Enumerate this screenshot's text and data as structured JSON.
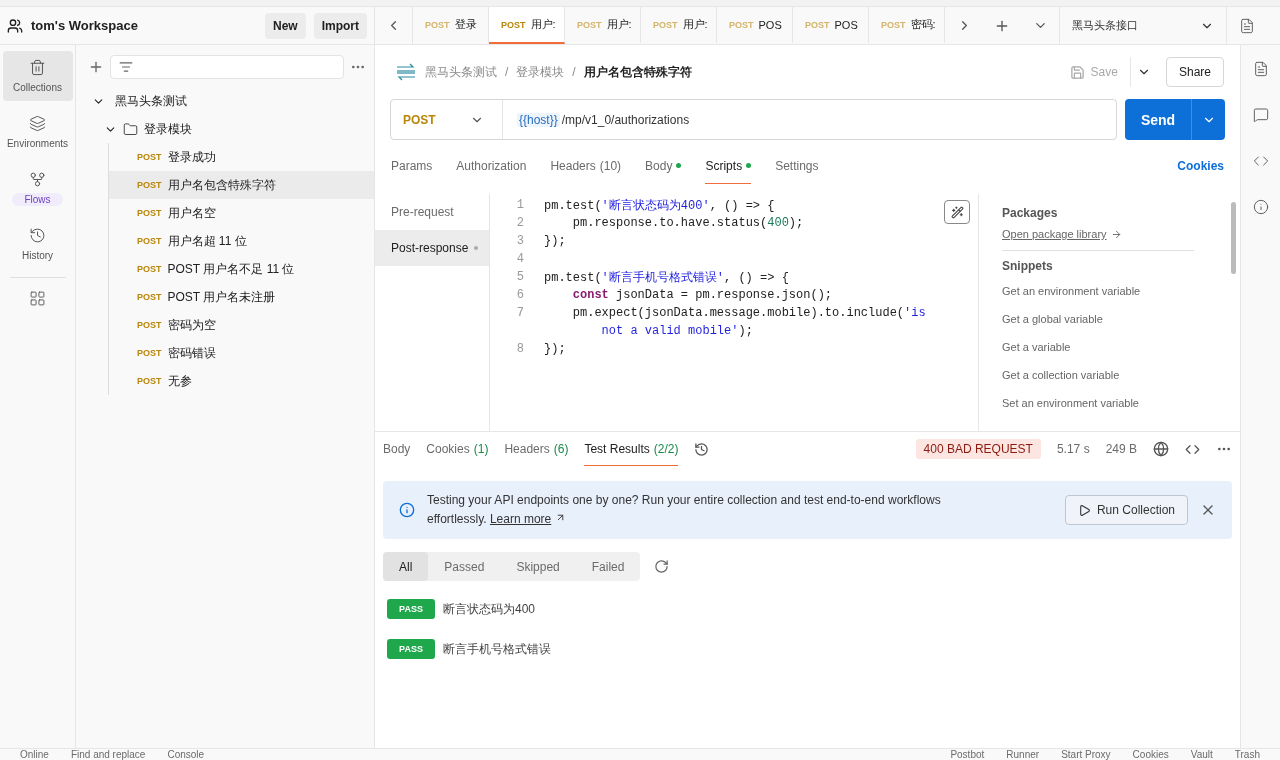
{
  "workspace": {
    "name": "tom's Workspace",
    "buttons": [
      "New",
      "Import"
    ]
  },
  "rail": [
    {
      "label": "Collections",
      "selected": true
    },
    {
      "label": "Environments",
      "selected": false
    },
    {
      "label": "Flows",
      "selected": false,
      "highlight": true
    },
    {
      "label": "History",
      "selected": false
    }
  ],
  "tree": [
    {
      "name": "黑马头条测试",
      "kind": "collection",
      "expanded": true,
      "children": [
        {
          "name": "登录模块",
          "kind": "folder",
          "expanded": true,
          "children": [
            {
              "kind": "request",
              "method": "POST",
              "name": "登录成功",
              "selected": false
            },
            {
              "kind": "request",
              "method": "POST",
              "name": "用户名包含特殊字符",
              "selected": true
            },
            {
              "kind": "request",
              "method": "POST",
              "name": "用户名空",
              "selected": false
            },
            {
              "kind": "request",
              "method": "POST",
              "name": "用户名超 11 位",
              "selected": false
            },
            {
              "kind": "request",
              "method": "POST",
              "name": "POST 用户名不足 11 位",
              "selected": false
            },
            {
              "kind": "request",
              "method": "POST",
              "name": "POST 用户名未注册",
              "selected": false
            },
            {
              "kind": "request",
              "method": "POST",
              "name": "密码为空",
              "selected": false
            },
            {
              "kind": "request",
              "method": "POST",
              "name": "密码错误",
              "selected": false
            },
            {
              "kind": "request",
              "method": "POST",
              "name": "无参",
              "selected": false
            }
          ]
        }
      ]
    }
  ],
  "tabs": [
    {
      "method": "POST",
      "title": "登录",
      "selected": false
    },
    {
      "method": "POST",
      "title": "用户:",
      "selected": true
    },
    {
      "method": "POST",
      "title": "用户:",
      "selected": false
    },
    {
      "method": "POST",
      "title": "用户:",
      "selected": false
    },
    {
      "method": "POST",
      "title": "POS",
      "selected": false
    },
    {
      "method": "POST",
      "title": "POS",
      "selected": false
    },
    {
      "method": "POST",
      "title": "密码:",
      "selected": false
    }
  ],
  "environment": "黑马头条接口",
  "breadcrumb": [
    {
      "kind": "crumb",
      "text": "黑马头条测试"
    },
    {
      "kind": "separator",
      "text": "/"
    },
    {
      "kind": "crumb",
      "text": "登录模块"
    },
    {
      "kind": "separator",
      "text": "/"
    },
    {
      "kind": "current",
      "text": "用户名包含特殊字符"
    }
  ],
  "actions": {
    "save": "Save",
    "share": "Share"
  },
  "request": {
    "method": "POST",
    "host": "{{host}}",
    "path": "/mp/v1_0/authorizations",
    "send": "Send"
  },
  "request_tabs": [
    {
      "label": "Params",
      "selected": false,
      "dot": false
    },
    {
      "label": "Authorization",
      "selected": false,
      "dot": false
    },
    {
      "label": "Headers",
      "count": "(10)",
      "selected": false,
      "dot": false
    },
    {
      "label": "Body",
      "selected": false,
      "dot": true
    },
    {
      "label": "Scripts",
      "selected": true,
      "dot": true
    },
    {
      "label": "Settings",
      "selected": false,
      "dot": false
    }
  ],
  "cookies_link": "Cookies",
  "script_tabs": [
    {
      "label": "Pre-request",
      "selected": false,
      "dot": false
    },
    {
      "label": "Post-response",
      "selected": true,
      "dot": true
    }
  ],
  "code": [
    {
      "number": "1",
      "tokens": [
        {
          "kind": "plain",
          "text": "pm.test("
        },
        {
          "kind": "string",
          "text": "'断言状态码为400'"
        },
        {
          "kind": "plain",
          "text": ", () => {"
        }
      ]
    },
    {
      "number": "2",
      "tokens": [
        {
          "kind": "plain",
          "text": "    pm.response.to.have.status("
        },
        {
          "kind": "number",
          "text": "400"
        },
        {
          "kind": "plain",
          "text": ");"
        }
      ]
    },
    {
      "number": "3",
      "tokens": [
        {
          "kind": "plain",
          "text": "});"
        }
      ]
    },
    {
      "number": "4"
    },
    {
      "number": "5",
      "tokens": [
        {
          "kind": "plain",
          "text": "pm.test("
        },
        {
          "kind": "string",
          "text": "'断言手机号格式错误'"
        },
        {
          "kind": "plain",
          "text": ", () => {"
        }
      ]
    },
    {
      "number": "6",
      "tokens": [
        {
          "kind": "keyword",
          "text": "    const"
        },
        {
          "kind": "plain",
          "text": " jsonData = pm.response.json();"
        }
      ]
    },
    {
      "number": "7",
      "tokens": [
        {
          "kind": "plain",
          "text": "    pm.expect(jsonData.message.mobile).to.include("
        },
        {
          "kind": "string",
          "text": "'is"
        }
      ]
    },
    {
      "tokens": [
        {
          "kind": "string",
          "text": "        not a valid mobile'"
        },
        {
          "kind": "plain",
          "text": ");"
        }
      ]
    },
    {
      "number": "8",
      "tokens": [
        {
          "kind": "plain",
          "text": "});"
        }
      ]
    }
  ],
  "snippets_panel": {
    "packages_title": "Packages",
    "packages_link": "Open package library",
    "snippets_title": "Snippets",
    "snippets": [
      "Get an environment variable",
      "Get a global variable",
      "Get a variable",
      "Get a collection variable",
      "Set an environment variable"
    ]
  },
  "response_tabs": [
    {
      "label": "Body",
      "selected": false
    },
    {
      "label": "Cookies",
      "count": "(1)",
      "selected": false
    },
    {
      "label": "Headers",
      "count": "(6)",
      "selected": false
    },
    {
      "label": "Test Results",
      "count": "(2/2)",
      "selected": true
    }
  ],
  "response_meta": {
    "status": "400 BAD REQUEST",
    "time": "5.17 s",
    "size": "249 B"
  },
  "banner": {
    "text": "Testing your API endpoints one by one? Run your entire collection and test end-to-end workflows effortlessly.",
    "link": "Learn more",
    "button": "Run Collection"
  },
  "filters": [
    {
      "label": "All",
      "selected": true
    },
    {
      "label": "Passed",
      "selected": false
    },
    {
      "label": "Skipped",
      "selected": false
    },
    {
      "label": "Failed",
      "selected": false
    }
  ],
  "results": [
    {
      "status": "PASS",
      "passed": true,
      "name": "断言状态码为400"
    },
    {
      "status": "PASS",
      "passed": true,
      "name": "断言手机号格式错误"
    }
  ],
  "status_bar": {
    "left": [
      "Online",
      "Find and replace",
      "Console"
    ],
    "right": [
      "Postbot",
      "Runner",
      "Start Proxy",
      "Cookies",
      "Vault",
      "Trash"
    ]
  }
}
